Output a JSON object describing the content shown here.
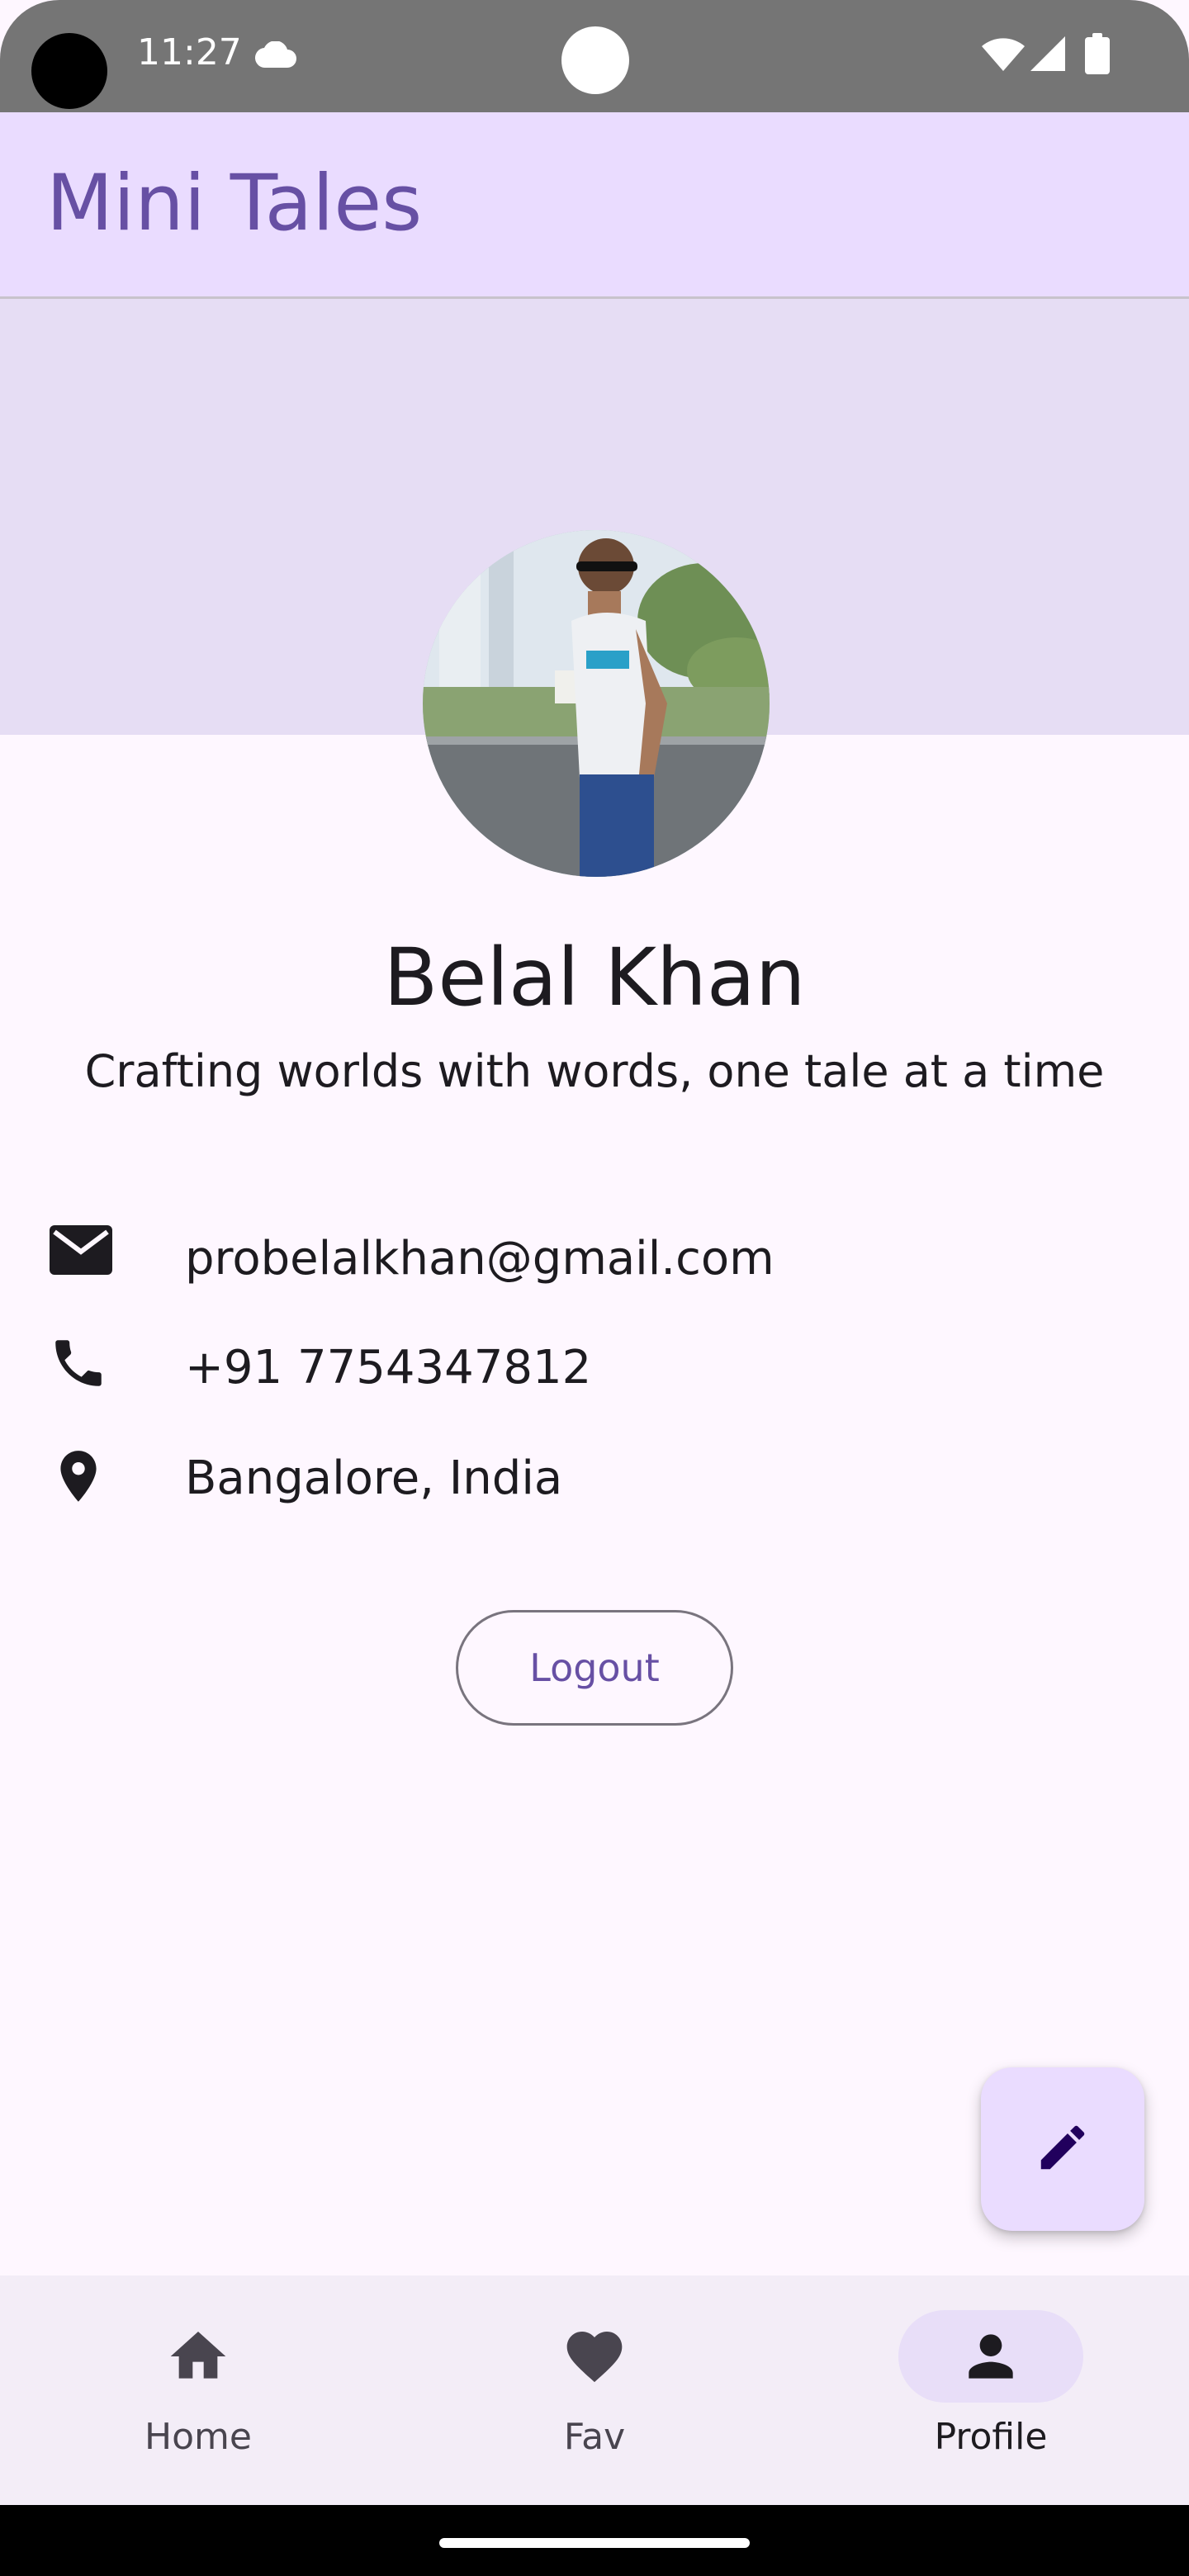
{
  "status_bar": {
    "time": "11:27",
    "icons": [
      "cloud-icon",
      "wifi-icon",
      "signal-icon",
      "battery-icon"
    ]
  },
  "app_bar": {
    "title": "Mini Tales"
  },
  "profile": {
    "name": "Belal Khan",
    "bio": "Crafting worlds with words, one tale at a time",
    "contacts": [
      {
        "icon": "email-icon",
        "text": "probelalkhan@gmail.com"
      },
      {
        "icon": "phone-icon",
        "text": "+91 7754347812"
      },
      {
        "icon": "location-icon",
        "text": "Bangalore, India"
      }
    ],
    "logout_label": "Logout"
  },
  "fab": {
    "icon": "edit-icon"
  },
  "bottom_nav": {
    "items": [
      {
        "icon": "home-icon",
        "label": "Home",
        "active": false
      },
      {
        "icon": "heart-icon",
        "label": "Fav",
        "active": false
      },
      {
        "icon": "person-icon",
        "label": "Profile",
        "active": true
      }
    ]
  },
  "colors": {
    "primary": "#6750a4",
    "app_bar_bg": "#eadcff",
    "cover_bg": "#e6ddf4",
    "surface": "#fef7ff",
    "nav_bg": "#f3edf7",
    "nav_active_pill": "#e8def8"
  }
}
